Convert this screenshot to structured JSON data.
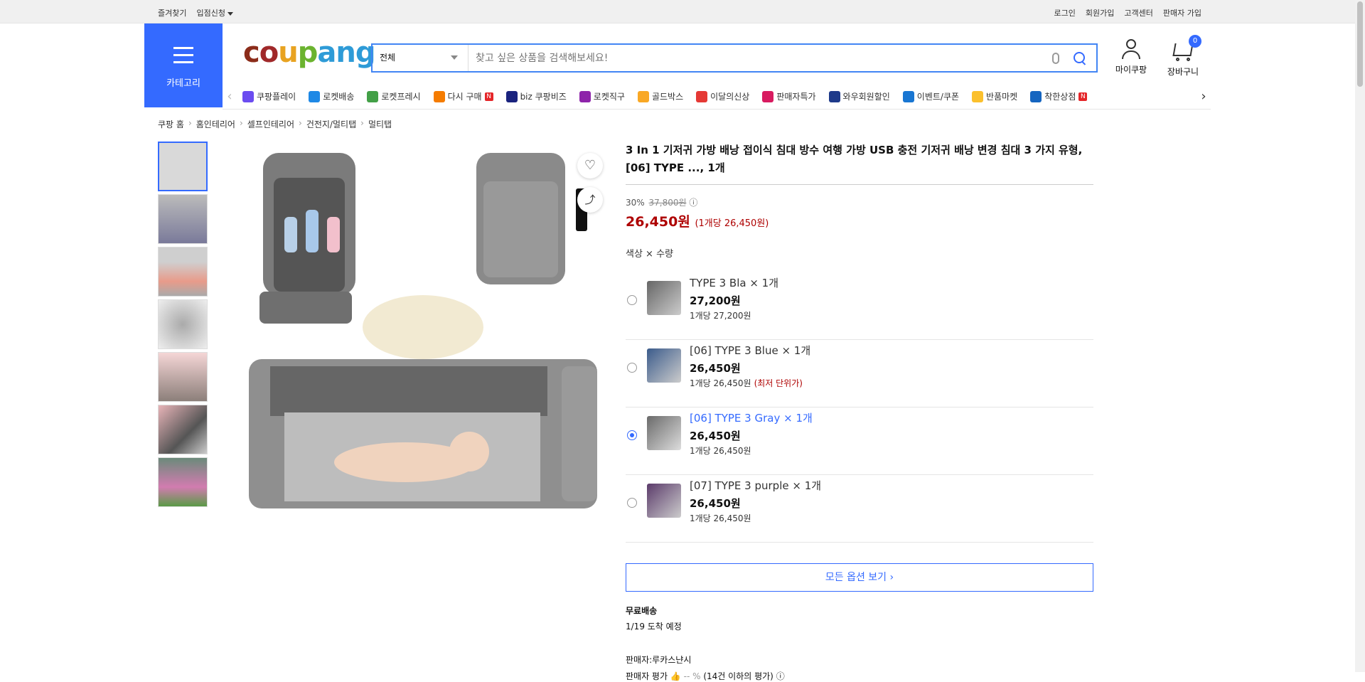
{
  "topbar": {
    "favorites": "즐겨찾기",
    "entry": "입점신청",
    "login": "로그인",
    "signup": "회원가입",
    "support": "고객센터",
    "seller_signup": "판매자 가입"
  },
  "header": {
    "category_label": "카테고리",
    "logo": [
      "c",
      "o",
      "u",
      "p",
      "a",
      "n",
      "g"
    ],
    "search_select": "전체",
    "search_placeholder": "찾고 싶은 상품을 검색해보세요!",
    "mycoupang": "마이쿠팡",
    "cart": "장바구니",
    "cart_count": "0"
  },
  "nav": [
    {
      "label": "쿠팡플레이",
      "color": "#6b4cf0"
    },
    {
      "label": "로켓배송",
      "color": "#1e88e5"
    },
    {
      "label": "로켓프레시",
      "color": "#43a047"
    },
    {
      "label": "다시 구매",
      "color": "#f57c00",
      "badge": "N"
    },
    {
      "label": "biz 쿠팡비즈",
      "color": "#1a237e"
    },
    {
      "label": "로켓직구",
      "color": "#8e24aa"
    },
    {
      "label": "골드박스",
      "color": "#f9a825"
    },
    {
      "label": "이달의신상",
      "color": "#e53935"
    },
    {
      "label": "판매자특가",
      "color": "#d81b60"
    },
    {
      "label": "와우회원할인",
      "color": "#1e3a8a"
    },
    {
      "label": "이벤트/쿠폰",
      "color": "#1976d2"
    },
    {
      "label": "반품마켓",
      "color": "#fbc02d"
    },
    {
      "label": "착한상점",
      "color": "#1565c0",
      "badge": "N"
    }
  ],
  "breadcrumb": [
    "쿠팡 홈",
    "홈인테리어",
    "셀프인테리어",
    "건전지/멀티탭",
    "멀티탭"
  ],
  "product": {
    "title": "3 In 1 기저귀 가방 배낭 접이식 침대 방수 여행 가방 USB 충전 기저귀 배낭 변경 침대 3 가지 유형, [06] TYPE ..., 1개",
    "discount": "30%",
    "original_price": "37,800원",
    "price": "26,450원",
    "unit_price": "(1개당 26,450원)",
    "option_header": "색상 × 수량",
    "options": [
      {
        "name": "TYPE 3 Bla × 1개",
        "price": "27,200원",
        "unit": "1개당 27,200원",
        "lowest": "",
        "img": "dark",
        "selected": false
      },
      {
        "name": "[06] TYPE 3 Blue × 1개",
        "price": "26,450원",
        "unit": "1개당 26,450원",
        "lowest": "(최저 단위가)",
        "img": "blue",
        "selected": false
      },
      {
        "name": "[06] TYPE 3 Gray × 1개",
        "price": "26,450원",
        "unit": "1개당 26,450원",
        "lowest": "",
        "img": "gray",
        "selected": true
      },
      {
        "name": "[07] TYPE 3 purple × 1개",
        "price": "26,450원",
        "unit": "1개당 26,450원",
        "lowest": "",
        "img": "purple",
        "selected": false
      }
    ],
    "all_options": "모든 옵션 보기 ›",
    "shipping_title": "무료배송",
    "shipping_date": "1/19 도착 예정",
    "seller": "판매자:루카스냔시",
    "rating_label": "판매자 평가",
    "rating_value": "-- %",
    "rating_note": "(14건 이하의 평가)"
  },
  "colors": {
    "accent": "#346aff",
    "price_red": "#ae0000"
  }
}
